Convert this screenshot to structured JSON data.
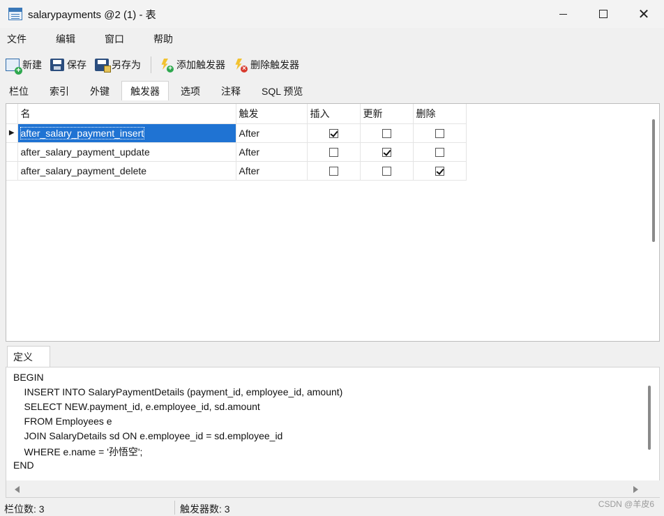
{
  "window": {
    "title": "salarypayments @2 (1) - 表"
  },
  "menu": [
    "文件",
    "编辑",
    "窗口",
    "帮助"
  ],
  "toolbar": {
    "new": "新建",
    "save": "保存",
    "save_as": "另存为",
    "add_trigger": "添加触发器",
    "delete_trigger": "删除触发器"
  },
  "tabs": [
    "栏位",
    "索引",
    "外键",
    "触发器",
    "选项",
    "注释",
    "SQL 预览"
  ],
  "active_tab": "触发器",
  "grid": {
    "columns": [
      "名",
      "触发",
      "插入",
      "更新",
      "删除"
    ],
    "rows": [
      {
        "name": "after_salary_payment_insert",
        "fire": "After",
        "insert": true,
        "update": false,
        "delete": false,
        "selected": true
      },
      {
        "name": "after_salary_payment_update",
        "fire": "After",
        "insert": false,
        "update": true,
        "delete": false,
        "selected": false
      },
      {
        "name": "after_salary_payment_delete",
        "fire": "After",
        "insert": false,
        "update": false,
        "delete": true,
        "selected": false
      }
    ]
  },
  "definition": {
    "tab_label": "定义",
    "lines": [
      "BEGIN",
      "    INSERT INTO SalaryPaymentDetails (payment_id, employee_id, amount)",
      "    SELECT NEW.payment_id, e.employee_id, sd.amount",
      "    FROM Employees e",
      "    JOIN SalaryDetails sd ON e.employee_id = sd.employee_id",
      "    WHERE e.name = '孙悟空';",
      "END"
    ]
  },
  "status": {
    "fields_count": "栏位数: 3",
    "triggers_count": "触发器数: 3"
  },
  "watermark": "CSDN @羊皮6"
}
